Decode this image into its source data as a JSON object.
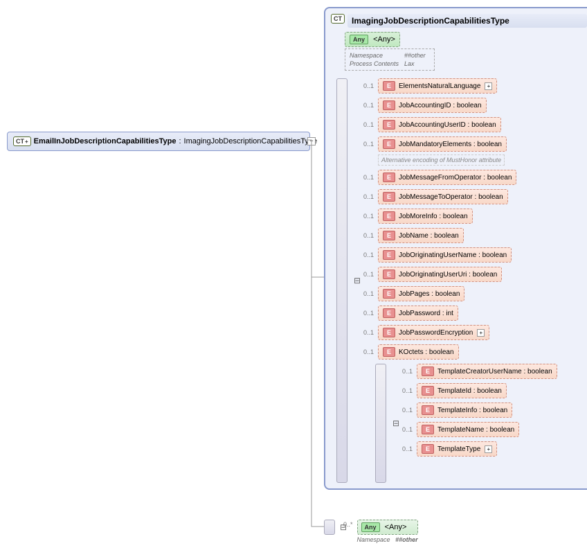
{
  "leftType": {
    "badge": "CT",
    "name": "EmailInJobDescriptionCapabilitiesType",
    "sep": ":",
    "base": "ImagingJobDescriptionCapabilitiesType"
  },
  "mainCT": {
    "badge": "CT",
    "title": "ImagingJobDescriptionCapabilitiesType",
    "any": {
      "badge": "Any",
      "label": "<Any>",
      "namespaceLabel": "Namespace",
      "namespaceValue": "##other",
      "processLabel": "Process Contents",
      "processValue": "Lax"
    }
  },
  "occur": "0..1",
  "elements": [
    {
      "name": "ElementsNaturalLanguage",
      "type": "",
      "expandable": true
    },
    {
      "name": "JobAccountingID",
      "type": "boolean"
    },
    {
      "name": "JobAccountingUserID",
      "type": "boolean"
    },
    {
      "name": "JobMandatoryElements",
      "type": "boolean",
      "annotation": "Alternative encoding of MustHonor attribute"
    },
    {
      "name": "JobMessageFromOperator",
      "type": "boolean"
    },
    {
      "name": "JobMessageToOperator",
      "type": "boolean"
    },
    {
      "name": "JobMoreInfo",
      "type": "boolean"
    },
    {
      "name": "JobName",
      "type": "boolean"
    },
    {
      "name": "JobOriginatingUserName",
      "type": "boolean"
    },
    {
      "name": "JobOriginatingUserUri",
      "type": "boolean"
    },
    {
      "name": "JobPages",
      "type": "boolean"
    },
    {
      "name": "JobPassword",
      "type": "int"
    },
    {
      "name": "JobPasswordEncryption",
      "type": "",
      "expandable": true
    },
    {
      "name": "KOctets ",
      "type": "boolean"
    }
  ],
  "templateElements": [
    {
      "name": "TemplateCreatorUserName",
      "type": "boolean"
    },
    {
      "name": "TemplateId",
      "type": "boolean"
    },
    {
      "name": "TemplateInfo",
      "type": "boolean"
    },
    {
      "name": "TemplateName",
      "type": "boolean"
    },
    {
      "name": "TemplateType",
      "type": "",
      "expandable": true
    }
  ],
  "bottomAny": {
    "occur": "0..*",
    "badge": "Any",
    "label": "<Any>",
    "nsLabel": "Namespace",
    "nsValue": "##other"
  }
}
